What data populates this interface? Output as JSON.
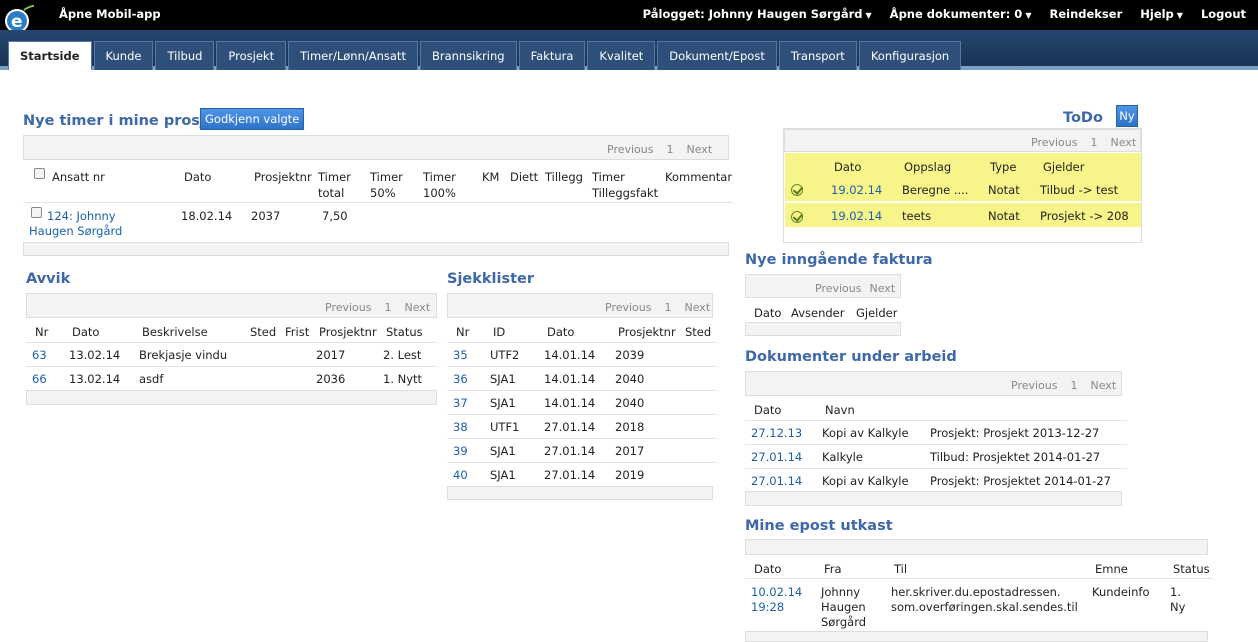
{
  "topbar": {
    "app_title": "Åpne Mobil-app",
    "logged_in": "Pålogget: Johnny Haugen Sørgård",
    "open_docs": "Åpne dokumenter: 0",
    "reindex": "Reindekser",
    "help": "Hjelp",
    "logout": "Logout"
  },
  "tabs": [
    "Startside",
    "Kunde",
    "Tilbud",
    "Prosjekt",
    "Timer/Lønn/Ansatt",
    "Brannsikring",
    "Faktura",
    "Kvalitet",
    "Dokument/Epost",
    "Transport",
    "Konfigurasjon"
  ],
  "pager": {
    "previous": "Previous",
    "page": "1",
    "next": "Next"
  },
  "timer": {
    "title": "Nye timer i mine prosjekt",
    "approve_button": "Godkjenn valgte",
    "headers": {
      "ansatt": "Ansatt nr",
      "dato": "Dato",
      "prosjektnr": "Prosjektnr",
      "timer_total_1": "Timer",
      "timer_total_2": "total",
      "timer50_1": "Timer",
      "timer50_2": "50%",
      "timer100_1": "Timer",
      "timer100_2": "100%",
      "km": "KM",
      "diett": "Diett",
      "tillegg": "Tillegg",
      "tf_1": "Timer",
      "tf_2": "Tilleggsfakt",
      "kommentar": "Kommentar"
    },
    "rows": [
      {
        "ansatt_1": "124: Johnny",
        "ansatt_2": "Haugen Sørgård",
        "dato": "18.02.14",
        "prosjektnr": "2037",
        "timer": "7,50"
      }
    ]
  },
  "todo": {
    "title": "ToDo",
    "new_button": "Ny",
    "headers": {
      "dato": "Dato",
      "oppslag": "Oppslag",
      "type": "Type",
      "gjelder": "Gjelder"
    },
    "rows": [
      {
        "dato": "19.02.14",
        "oppslag": "Beregne ....",
        "type": "Notat",
        "gjelder": "Tilbud -> test"
      },
      {
        "dato": "19.02.14",
        "oppslag": "teets",
        "type": "Notat",
        "gjelder": "Prosjekt -> 208"
      }
    ]
  },
  "avvik": {
    "title": "Avvik",
    "headers": {
      "nr": "Nr",
      "dato": "Dato",
      "beskrivelse": "Beskrivelse",
      "sted": "Sted",
      "frist": "Frist",
      "prosjektnr": "Prosjektnr",
      "status": "Status"
    },
    "rows": [
      {
        "nr": "63",
        "dato": "13.02.14",
        "beskrivelse": "Brekjasje vindu",
        "prosjektnr": "2017",
        "status": "2. Lest"
      },
      {
        "nr": "66",
        "dato": "13.02.14",
        "beskrivelse": "asdf",
        "prosjektnr": "2036",
        "status": "1. Nytt"
      }
    ]
  },
  "sjekk": {
    "title": "Sjekklister",
    "headers": {
      "nr": "Nr",
      "id": "ID",
      "dato": "Dato",
      "prosjektnr": "Prosjektnr",
      "sted": "Sted"
    },
    "rows": [
      {
        "nr": "35",
        "id": "UTF2",
        "dato": "14.01.14",
        "prosjektnr": "2039"
      },
      {
        "nr": "36",
        "id": "SJA1",
        "dato": "14.01.14",
        "prosjektnr": "2040"
      },
      {
        "nr": "37",
        "id": "SJA1",
        "dato": "14.01.14",
        "prosjektnr": "2040"
      },
      {
        "nr": "38",
        "id": "UTF1",
        "dato": "27.01.14",
        "prosjektnr": "2018"
      },
      {
        "nr": "39",
        "id": "SJA1",
        "dato": "27.01.14",
        "prosjektnr": "2017"
      },
      {
        "nr": "40",
        "id": "SJA1",
        "dato": "27.01.14",
        "prosjektnr": "2019"
      }
    ]
  },
  "faktura": {
    "title": "Nye inngående faktura",
    "headers": {
      "dato": "Dato",
      "avsender": "Avsender",
      "gjelder": "Gjelder"
    }
  },
  "dokumenter": {
    "title": "Dokumenter under arbeid",
    "headers": {
      "dato": "Dato",
      "navn": "Navn"
    },
    "rows": [
      {
        "dato": "27.12.13",
        "navn": "Kopi av Kalkyle",
        "ref": "Prosjekt: Prosjekt 2013-12-27"
      },
      {
        "dato": "27.01.14",
        "navn": "Kalkyle",
        "ref": "Tilbud: Prosjektet 2014-01-27"
      },
      {
        "dato": "27.01.14",
        "navn": "Kopi av Kalkyle",
        "ref": "Prosjekt: Prosjektet 2014-01-27"
      }
    ]
  },
  "epost": {
    "title": "Mine epost utkast",
    "headers": {
      "dato": "Dato",
      "fra": "Fra",
      "til": "Til",
      "emne": "Emne",
      "status": "Status"
    },
    "rows": [
      {
        "dato_1": "10.02.14",
        "dato_2": "19:28",
        "fra_1": "Johnny",
        "fra_2": "Haugen",
        "fra_3": "Sørgård",
        "til_1": "her.skriver.du.epostadressen.",
        "til_2": "som.overføringen.skal.sendes.til",
        "emne": "Kundeinfo",
        "status_1": "1.",
        "status_2": "Ny"
      }
    ]
  }
}
